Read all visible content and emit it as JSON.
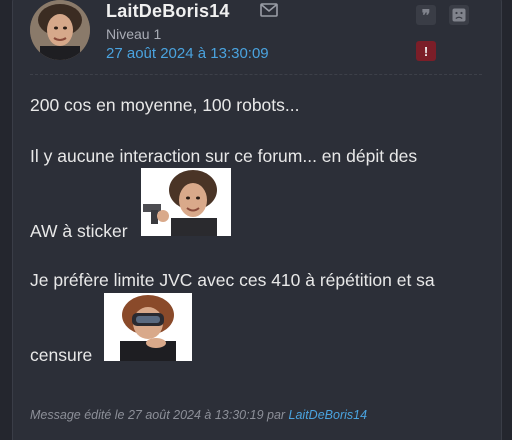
{
  "post": {
    "username": "LaitDeBoris14",
    "level": "Niveau 1",
    "date": "27 août 2024 à 13:30:09",
    "paragraphs": [
      "200 cos en moyenne, 100 robots...",
      "Il y aucune interaction sur ce forum... en dépit des",
      "AW à sticker",
      "Je préfère limite JVC avec ces 410 à répétition et sa",
      "censure"
    ],
    "alert_symbol": "!",
    "quote_symbol": "❞",
    "edit_prefix": "Message édité le 27 août 2024 à 13:30:19 par ",
    "edit_author": "LaitDeBoris14"
  },
  "icons": {
    "mail": "mail-icon",
    "quote": "quote-icon",
    "sad": "sad-face-icon",
    "alert": "alert-icon"
  },
  "colors": {
    "background": "#24262e",
    "card": "#2c2f38",
    "link": "#4aa3df",
    "alert": "#7b1e28"
  }
}
